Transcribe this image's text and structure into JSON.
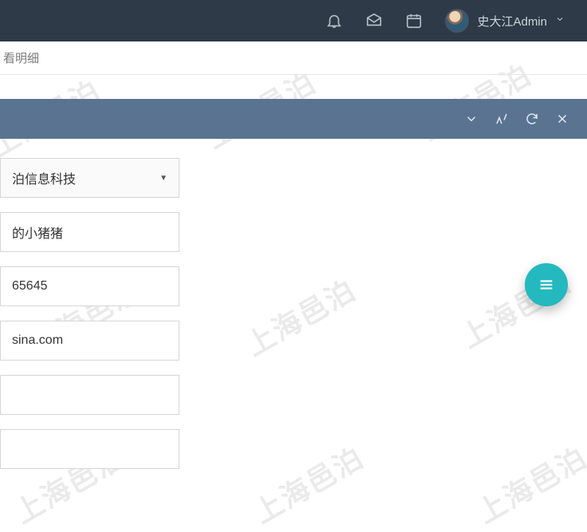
{
  "watermark": "上海邑泊",
  "header": {
    "user_name": "史大江Admin"
  },
  "breadcrumb": {
    "title": "看明细"
  },
  "panel": {
    "fields": {
      "company": "泊信息科技",
      "nickname": "的小猪猪",
      "phone": "65645",
      "email": "sina.com",
      "extra1": "",
      "extra2": ""
    }
  }
}
